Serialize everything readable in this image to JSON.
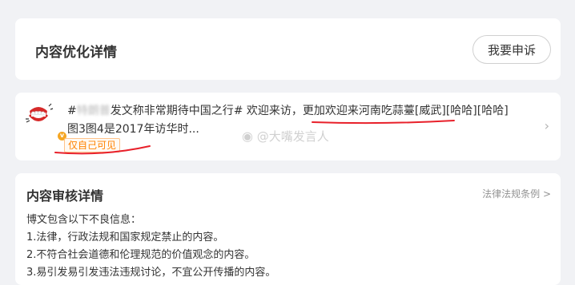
{
  "header": {
    "title": "内容优化详情",
    "appeal_button": "我要申诉"
  },
  "post": {
    "line1_prefix": "#",
    "line1_blurred": "特朗普",
    "line1_rest": "发文称非常期待中国之行# 欢迎来访，",
    "line1_highlight": "更加欢迎来河南吃蒜薹[威武][哈哈][哈哈]",
    "line2": "图3图4是2017年访华时...",
    "visibility": "仅自己可见",
    "watermark": "@大嘴发言人"
  },
  "review": {
    "title": "内容审核详情",
    "laws_link": "法律法规条例 >",
    "lines": [
      "博文包含以下不良信息：",
      "1.法律，行政法规和国家规定禁止的内容。",
      "2.不符合社会道德和伦理规范的价值观念的内容。",
      "3.易引发易引发违法违规讨论，不宜公开传播的内容。"
    ]
  },
  "colors": {
    "background": "#f1f2f5",
    "card": "#ffffff",
    "accent_orange": "#ff8200",
    "marker_red": "#e8202a"
  }
}
